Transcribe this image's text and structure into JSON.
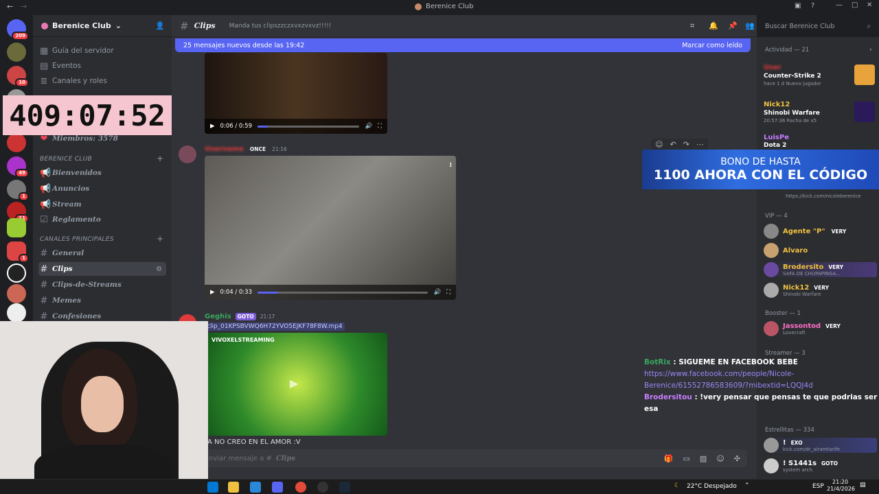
{
  "window": {
    "title": "Berenice Club"
  },
  "server": {
    "name": "Berenice Club"
  },
  "rail_badges": [
    "209",
    "10",
    "49",
    "1",
    "11",
    "1"
  ],
  "sidebar": {
    "top_items": [
      "Guía del servidor",
      "Eventos",
      "Canales y roles"
    ],
    "members_count": "Miembros: 3578",
    "category1": "BERENICE CLUB",
    "cat1_channels": [
      "Bienvenidos",
      "Anuncios",
      "Stream",
      "Reglamento"
    ],
    "category2": "CANALES PRINCIPALES",
    "cat2_channels": [
      "General",
      "Clips",
      "Clips-de-Streams",
      "Memes",
      "Confesiones"
    ]
  },
  "chat": {
    "channel": "Clips",
    "topic": "Manda tus clipszzczxvxzvxvz!!!!!",
    "new_messages": "25 mensajes nuevos desde las 19:42",
    "mark_read": "Marcar como leído",
    "video1_time": "0:06 / 0:59",
    "msg2_tag": "ONCE",
    "msg2_time": "21:16",
    "video2_time": "0:04 / 0:33",
    "msg3_user": "Geghis",
    "msg3_tag": "GOTO",
    "msg3_time": "21:17",
    "msg3_file": "clip_01KPSBVWQ6H72YVO5EJKF78F8W.mp4",
    "video3_label": "VIVOXELSTREAMING",
    "msg3_caption": "A NO CREO EN EL AMOR :V",
    "input_placeholder": "nviar mensaje a #",
    "input_channel": "Clips"
  },
  "search": {
    "placeholder": "Buscar Berenice Club"
  },
  "members": {
    "activity_header": "Actividad — 21",
    "activity": [
      {
        "game": "Counter-Strike 2",
        "sub": "hace 1 d  Nuevo jugador"
      },
      {
        "name": "Nick12",
        "game": "Shinobi Warfare",
        "sub": "20:57:36  Racha de x5"
      },
      {
        "name": "LuisPe",
        "game": "Dota 2"
      }
    ],
    "kick_link": "https://kick.com/nicoleberenice",
    "vip_header": "VIP — 4",
    "vip": [
      {
        "name": "Agente \"P\"",
        "tag": "VERY"
      },
      {
        "name": "Alvaro"
      },
      {
        "name": "Brodersito",
        "tag": "VERY",
        "sub": "SAFA DE CHUPAPINGA..."
      },
      {
        "name": "Nick12",
        "tag": "VERY",
        "sub": "Shinobi Warfare"
      }
    ],
    "booster_header": "Booster — 1",
    "booster": {
      "name": "Jassontod",
      "tag": "VERY",
      "sub": "Lovecraft"
    },
    "streamer_header": "Streamer — 3",
    "estrellitas_header": "Estrellitas — 334",
    "estrellitas": [
      {
        "name": "!",
        "tag": "EXO",
        "sub": "kick.com/dr_airamtarife"
      },
      {
        "name": "! S1441s",
        "tag": "GOTO",
        "sub": "system arch."
      }
    ]
  },
  "overlays": {
    "timer": "409:07:52",
    "promo_line1": "BONO DE HASTA",
    "promo_line2": "1100 AHORA CON EL CÓDIGO",
    "chat_lines": [
      {
        "user": "BotRix",
        "text": ": SIGUEME EN FACEBOOK BEBE"
      },
      {
        "link": "https://www.facebook.com/people/Nicole-Berenice/61552786583609/?mibextid=LQQJ4d"
      },
      {
        "user": "Brodersitou",
        "text": ": !very pensar que pensas te que podrias ser esa"
      }
    ]
  },
  "taskbar": {
    "weather": "22°C  Despejado",
    "lang": "ESP",
    "time": "21:20",
    "date": "21/4/2026"
  },
  "colors": {
    "accent": "#5865f2",
    "bg": "#313338",
    "sidebar": "#2b2d31"
  }
}
